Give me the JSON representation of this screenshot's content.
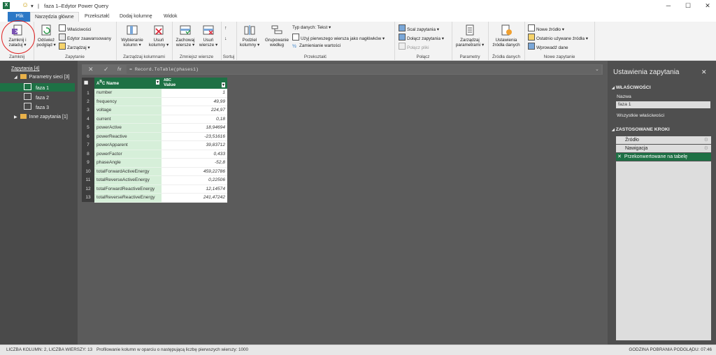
{
  "window": {
    "title": "faza 1–Edytor Power Query",
    "emoji": "☺",
    "controls": [
      "─",
      "☐",
      "✕"
    ]
  },
  "tabs": [
    "Plik",
    "Narzędzia główne",
    "Przekształć",
    "Dodaj kolumnę",
    "Widok"
  ],
  "ribbon": {
    "zamknij": {
      "label1": "Zamknij i",
      "label2": "załaduj ▾",
      "group": "Zamknij"
    },
    "zapytanie": {
      "odswiez1": "Odśwież",
      "odswiez2": "podgląd ▾",
      "wlasciwosci": "Właściwości",
      "edytor": "Edytor zaawansowany",
      "zarzadzaj": "Zarządzaj ▾",
      "group": "Zapytanie"
    },
    "kolumny": {
      "wybieranie1": "Wybieranie",
      "wybieranie2": "kolumn ▾",
      "usun1": "Usuń",
      "usun2": "kolumny ▾",
      "group": "Zarządzaj kolumnami"
    },
    "wiersze": {
      "zachowaj1": "Zachowaj",
      "zachowaj2": "wiersze ▾",
      "usunw1": "Usuń",
      "usunw2": "wiersze ▾",
      "group": "Zmniejsz wiersze"
    },
    "sortuj": {
      "group": "Sortuj"
    },
    "przeksztalc": {
      "podziel1": "Podziel",
      "podziel2": "kolumny ▾",
      "grupowanie1": "Grupowanie",
      "grupowanie2": "według",
      "typ": "Typ danych: Tekst ▾",
      "naglowki": "Użyj pierwszego wiersza jako nagłówków ▾",
      "zamienianie": "Zamienianie wartości",
      "group": "Przekształć"
    },
    "polacz": {
      "scal": "Scal zapytania ▾",
      "dolacz": "Dołącz zapytania ▾",
      "pliki": "Połącz pliki",
      "group": "Połącz"
    },
    "parametry": {
      "b1": "Zarządzaj",
      "b2": "parametrami ▾",
      "group": "Parametry"
    },
    "zrodla": {
      "b1": "Ustawienia",
      "b2": "źródła danych",
      "group": "Źródła danych"
    },
    "nowe": {
      "nowe_zrodlo": "Nowe źródło ▾",
      "ostatnio": "Ostatnio używane źródła ▾",
      "wprowadz": "Wprowadź dane",
      "group": "Nowe zapytanie"
    }
  },
  "queries": {
    "header": "Zapytania [4]",
    "items": [
      {
        "label": "Parametry sieci [3]",
        "type": "folder"
      },
      {
        "label": "faza 1",
        "type": "table"
      },
      {
        "label": "faza 2",
        "type": "table"
      },
      {
        "label": "faza 3",
        "type": "table"
      },
      {
        "label": "Inne zapytania [1]",
        "type": "folder"
      }
    ]
  },
  "formula": {
    "text": "= Record.ToTable(phases1)",
    "cancel": "✕",
    "confirm": "✓",
    "fx": "fx"
  },
  "table": {
    "columns": [
      "Name",
      "Value"
    ],
    "rows": [
      [
        "1",
        "number",
        "1"
      ],
      [
        "2",
        "frequency",
        "49,99"
      ],
      [
        "3",
        "voltage",
        "224,97"
      ],
      [
        "4",
        "current",
        "0,18"
      ],
      [
        "5",
        "powerActive",
        "18,94694"
      ],
      [
        "6",
        "powerReactive",
        "-23,51616"
      ],
      [
        "7",
        "powerApparent",
        "39,83712"
      ],
      [
        "8",
        "powerFactor",
        "0,433"
      ],
      [
        "9",
        "phaseAngle",
        "-52,8"
      ],
      [
        "10",
        "totalForwardActiveEnergy",
        "459,22786"
      ],
      [
        "11",
        "totalReverseActiveEnergy",
        "0,22506"
      ],
      [
        "12",
        "totalForwardReactiveEnergy",
        "12,14574"
      ],
      [
        "13",
        "totalReverseReactiveEnergy",
        "241,47242"
      ]
    ]
  },
  "settings": {
    "title": "Ustawienia zapytania",
    "close": "✕",
    "props_header": "WŁAŚCIWOŚCI",
    "name_label": "Nazwa",
    "name_value": "faza 1",
    "all_props": "Wszystkie właściwości",
    "steps_header": "ZASTOSOWANE KROKI",
    "steps": [
      "Źródło",
      "Nawigacja",
      "Przekonwertowane na tabelę"
    ]
  },
  "status": {
    "left": "LICZBA KOLUMN: 2, LICZBA WIERSZY: 13",
    "middle": "Profilowanie kolumn w oparciu o następującą liczbę pierwszych wierszy: 1000",
    "right": "GODZINA POBRANIA PODGLĄDU: 07:46"
  },
  "colors": {
    "accent": "#2b78c6",
    "green": "#1e7145",
    "annotation": "#e02020"
  }
}
